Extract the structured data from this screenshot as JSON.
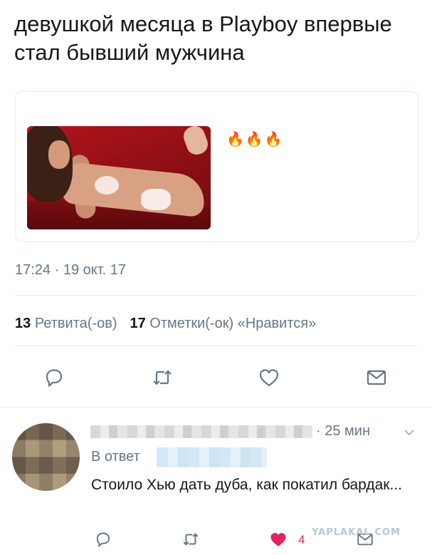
{
  "tweet": {
    "text": "девушкой месяца в Playboy впервые стал бывший мужчина",
    "card_emoji": "🔥🔥🔥",
    "timestamp": "17:24 · 19 окт. 17",
    "retweets_count": "13",
    "retweets_label": "Ретвита(-ов)",
    "likes_count": "17",
    "likes_label": "Отметки(-ок) «Нравится»"
  },
  "actions": {
    "icons": [
      "reply-icon",
      "retweet-icon",
      "like-icon",
      "message-icon"
    ],
    "color": "#657786"
  },
  "reply": {
    "time": "· 25 мин",
    "reply_to_label": "В ответ",
    "text": "Стоило Хью дать дуба, как покатил бардак...",
    "likes": "4",
    "like_color": "#e0245e",
    "icons": [
      "reply-icon",
      "retweet-icon",
      "heart-filled-icon",
      "message-icon",
      "chevron-down-icon"
    ]
  },
  "watermark": "YAPLAKAL.COM"
}
